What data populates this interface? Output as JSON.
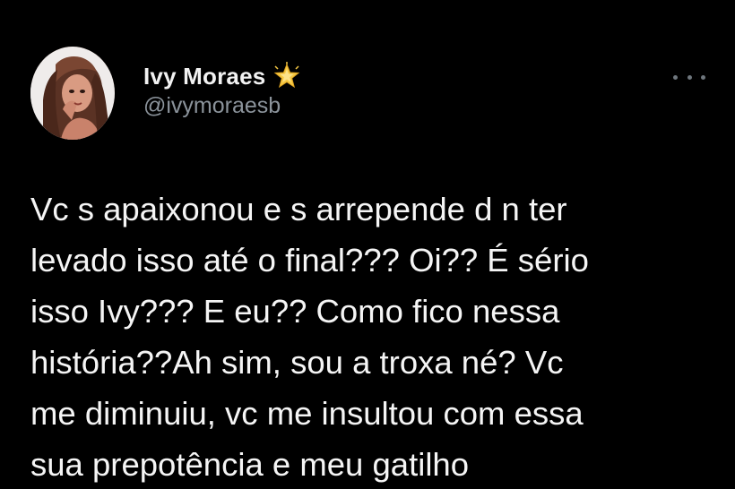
{
  "author": {
    "display_name": "Ivy Moraes",
    "handle": "@ivymoraesb",
    "badge_icon": "star-emoji-icon",
    "avatar_icon": "profile-photo"
  },
  "more_icon": "more-horizontal-icon",
  "tweet": {
    "lines": [
      "Vc s apaixonou e s arrepende d n ter",
      "levado isso até o final??? Oi?? É sério",
      "isso Ivy??? E eu?? Como fico nessa",
      "história??Ah sim, sou a troxa né? Vc",
      "me diminuiu, vc me insultou com essa",
      "sua prepotência e meu gatilho"
    ]
  },
  "colors": {
    "background": "#000000",
    "text": "#f5f5f5",
    "secondary_text": "#8b939b",
    "star": "#f6c945"
  }
}
